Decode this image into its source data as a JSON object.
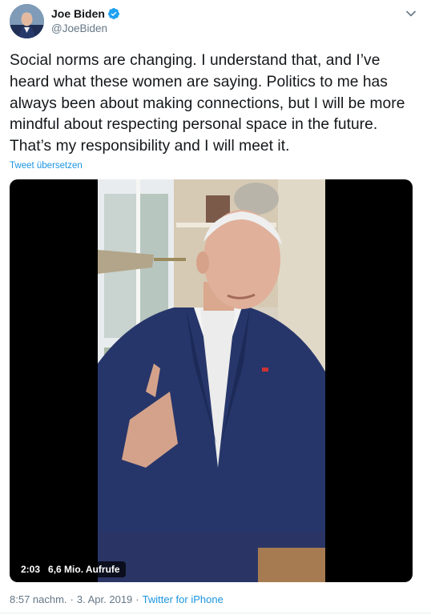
{
  "author": {
    "display_name": "Joe Biden",
    "handle": "@JoeBiden",
    "verified": true,
    "avatar": "profile-photo"
  },
  "tweet": {
    "text": "Social norms are changing. I understand that, and I’ve heard what these women are saying. Politics to me has always been about making connections, but I will be more mindful about respecting personal space in the future. That’s my responsibility and I will meet it.",
    "translate_label": "Tweet übersetzen"
  },
  "video": {
    "duration": "2:03",
    "views": "6,6 Mio. Aufrufe"
  },
  "footer": {
    "time": "8:57 nachm.",
    "separator": "·",
    "date": "3. Apr. 2019",
    "source": "Twitter for iPhone"
  },
  "icons": {
    "verified": "verified-badge-icon",
    "menu": "chevron-down-icon"
  },
  "colors": {
    "accent": "#1b95e0",
    "secondary_text": "#657786",
    "primary_text": "#14171a",
    "verified": "#1da1f2"
  }
}
